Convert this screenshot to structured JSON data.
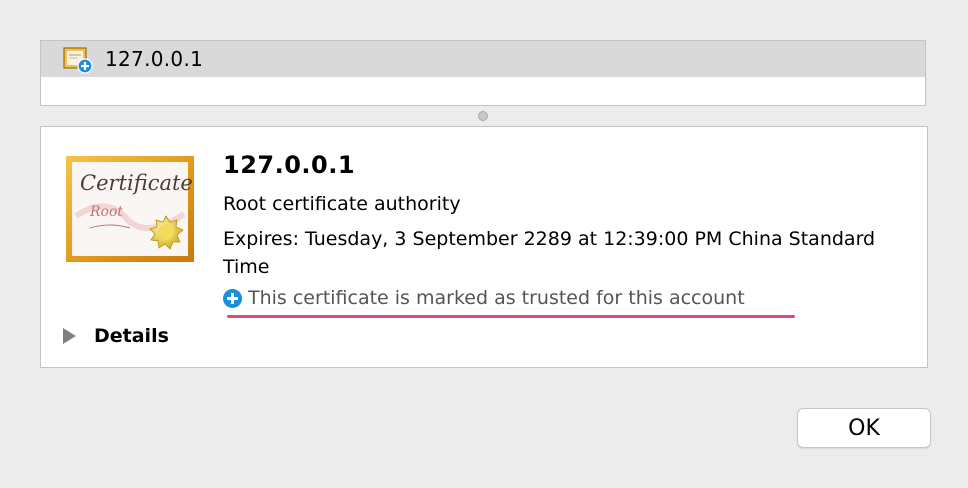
{
  "list": {
    "row_title": "127.0.0.1"
  },
  "detail": {
    "certificate_image_text": "Certificate",
    "certificate_image_subtext": "Root",
    "title": "127.0.0.1",
    "subtitle": "Root certificate authority",
    "expires": "Expires: Tuesday, 3 September 2289 at 12:39:00 PM China Standard Time",
    "trust_status": "This certificate is marked as trusted for this account",
    "details_label": "Details"
  },
  "footer": {
    "ok_label": "OK"
  },
  "colors": {
    "selection_row": "#d9d9d9",
    "trust_badge": "#1a8fdc",
    "annotation_underline": "#e8457a"
  },
  "icons": {
    "row_icon": "certificate-icon",
    "trust_icon": "plus-circle-icon",
    "details_toggle": "disclosure-triangle-icon"
  }
}
